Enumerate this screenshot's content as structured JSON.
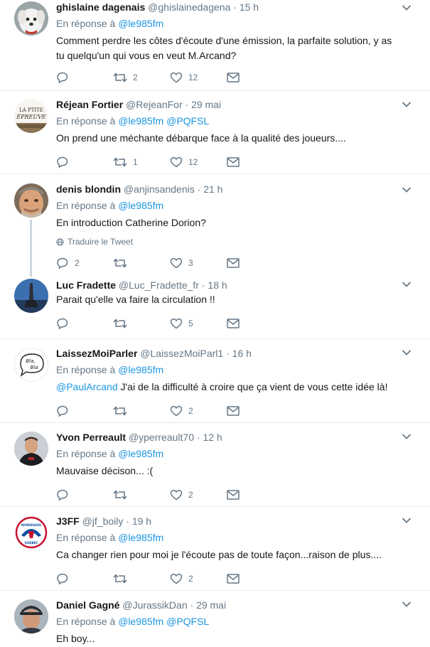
{
  "tweets": [
    {
      "name": "ghislaine dagenais",
      "handle": "@ghislainedagena",
      "sep": "·",
      "time": "15 h",
      "reply_prefix": "En réponse à",
      "reply_to": "@le985fm",
      "reply_to_2": "",
      "text_mention": "",
      "text": "Comment perdre les côtes d'écoute d'une émission, la parfaite solution, y as tu quelqu'un qui vous en veut M.Arcand?",
      "replies": "",
      "retweets": "2",
      "likes": "12",
      "avatar": "white-dog-avatar"
    },
    {
      "name": "Réjean Fortier",
      "handle": "@RejeanFor",
      "sep": "·",
      "time": "29 mai",
      "reply_prefix": "En réponse à",
      "reply_to": "@le985fm",
      "reply_to_2": "@PQFSL",
      "text_mention": "",
      "text": "On prend une méchante débarque face à la qualité des joueurs....",
      "replies": "",
      "retweets": "1",
      "likes": "12",
      "avatar": "la-ptite-epreuve-logo-avatar",
      "avatar_text_1": "LA PTITE",
      "avatar_text_2": "ÉPREUVE"
    },
    {
      "name": "denis blondin",
      "handle": "@anjinsandenis",
      "sep": "·",
      "time": "21 h",
      "reply_prefix": "En réponse à",
      "reply_to": "@le985fm",
      "reply_to_2": "",
      "text_mention": "",
      "text": "En introduction Catherine Dorion?",
      "translate": "Traduire le Tweet",
      "replies": "2",
      "retweets": "",
      "likes": "3",
      "avatar": "man-face-avatar"
    },
    {
      "name": "Luc Fradette",
      "handle": "@Luc_Fradette_fr",
      "sep": "·",
      "time": "18 h",
      "text": "Parait qu'elle va faire la circulation !!",
      "replies": "",
      "retweets": "",
      "likes": "5",
      "avatar": "tower-sky-avatar"
    },
    {
      "name": "LaissezMoiParler",
      "handle": "@LaissezMoiParl1",
      "sep": "·",
      "time": "16 h",
      "reply_prefix": "En réponse à",
      "reply_to": "@le985fm",
      "reply_to_2": "",
      "text_mention": "@PaulArcand",
      "text": "J'ai de la difficulté à croire que ça vient de vous cette idée là!",
      "replies": "",
      "retweets": "",
      "likes": "2",
      "avatar": "bla-bla-bubble-avatar",
      "avatar_text_1": "Bla,",
      "avatar_text_2": "Bla"
    },
    {
      "name": "Yvon Perreault",
      "handle": "@yperreault70",
      "sep": "·",
      "time": "12 h",
      "reply_prefix": "En réponse à",
      "reply_to": "@le985fm",
      "reply_to_2": "",
      "text_mention": "",
      "text": "Mauvaise décison... :(",
      "replies": "",
      "retweets": "",
      "likes": "2",
      "avatar": "man-dark-shirt-avatar"
    },
    {
      "name": "J3FF",
      "handle": "@jf_boily",
      "sep": "·",
      "time": "19 h",
      "reply_prefix": "En réponse à",
      "reply_to": "@le985fm",
      "reply_to_2": "",
      "text_mention": "",
      "text": "Ca changer rien pour moi je l'écoute pas de toute façon...raison de plus....",
      "replies": "",
      "retweets": "",
      "likes": "2",
      "avatar": "nordiques-logo-avatar",
      "avatar_text_1": "NORDIQUES",
      "avatar_text_2": "QUEBEC"
    },
    {
      "name": "Daniel Gagné",
      "handle": "@JurassikDan",
      "sep": "·",
      "time": "29 mai",
      "reply_prefix": "En réponse à",
      "reply_to": "@le985fm",
      "reply_to_2": "@PQFSL",
      "text_mention": "",
      "text": "Eh boy...",
      "avatar": "man-cap-avatar"
    }
  ],
  "colors": {
    "link": "#1b95e0",
    "secondary": "#657786",
    "divider": "#e6ecf0",
    "thread_line": "#ccd6dd"
  },
  "icons": {
    "reply": "reply-icon",
    "retweet": "retweet-icon",
    "like": "heart-icon",
    "dm": "mail-icon",
    "more": "chevron-down-icon",
    "translate": "globe-icon"
  }
}
